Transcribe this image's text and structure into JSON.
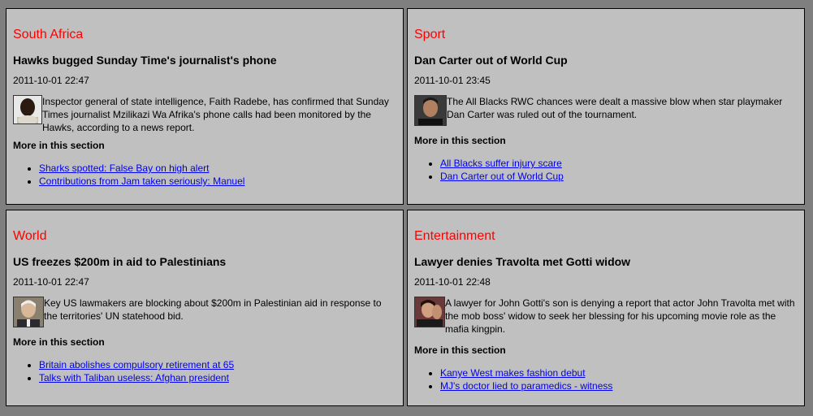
{
  "more_label": "More in this section",
  "colors": {
    "page_bg": "#7f7f7f",
    "panel_bg": "#c0c0c0",
    "section_title": "#ff0000",
    "link": "#0000ee"
  },
  "panels": [
    {
      "section": "South Africa",
      "headline": "Hawks bugged Sunday Time's journalist's phone",
      "timestamp": "2011-10-01 22:47",
      "thumbnail_icon": "person-photo-icon",
      "summary": "Inspector general of state intelligence, Faith Radebe, has confirmed that Sunday Times journalist Mzilikazi Wa Afrika's phone calls had been monitored by the Hawks, according to a news report.",
      "links": [
        "Sharks spotted: False Bay on high alert",
        "Contributions from Jam taken seriously: Manuel"
      ]
    },
    {
      "section": "Sport",
      "headline": "Dan Carter out of World Cup",
      "timestamp": "2011-10-01 23:45",
      "thumbnail_icon": "person-photo-icon",
      "summary": "The All Blacks RWC chances were dealt a massive blow when star playmaker Dan Carter was ruled out of the tournament.",
      "links": [
        "All Blacks suffer injury scare",
        "Dan Carter out of World Cup"
      ]
    },
    {
      "section": "World",
      "headline": "US freezes $200m in aid to Palestinians",
      "timestamp": "2011-10-01 22:47",
      "thumbnail_icon": "person-photo-icon",
      "summary": "Key US lawmakers are blocking about $200m in Palestinian aid in response to the territories' UN statehood bid.",
      "links": [
        "Britain abolishes compulsory retirement at 65",
        "Talks with Taliban useless: Afghan president"
      ]
    },
    {
      "section": "Entertainment",
      "headline": "Lawyer denies Travolta met Gotti widow",
      "timestamp": "2011-10-01 22:48",
      "thumbnail_icon": "person-photo-icon",
      "summary": "A lawyer for John Gotti's son is denying a report that actor John Travolta met with the mob boss' widow to seek her blessing for his upcoming movie role as the mafia kingpin.",
      "links": [
        "Kanye West makes fashion debut",
        "MJ's doctor lied to paramedics - witness"
      ]
    }
  ]
}
